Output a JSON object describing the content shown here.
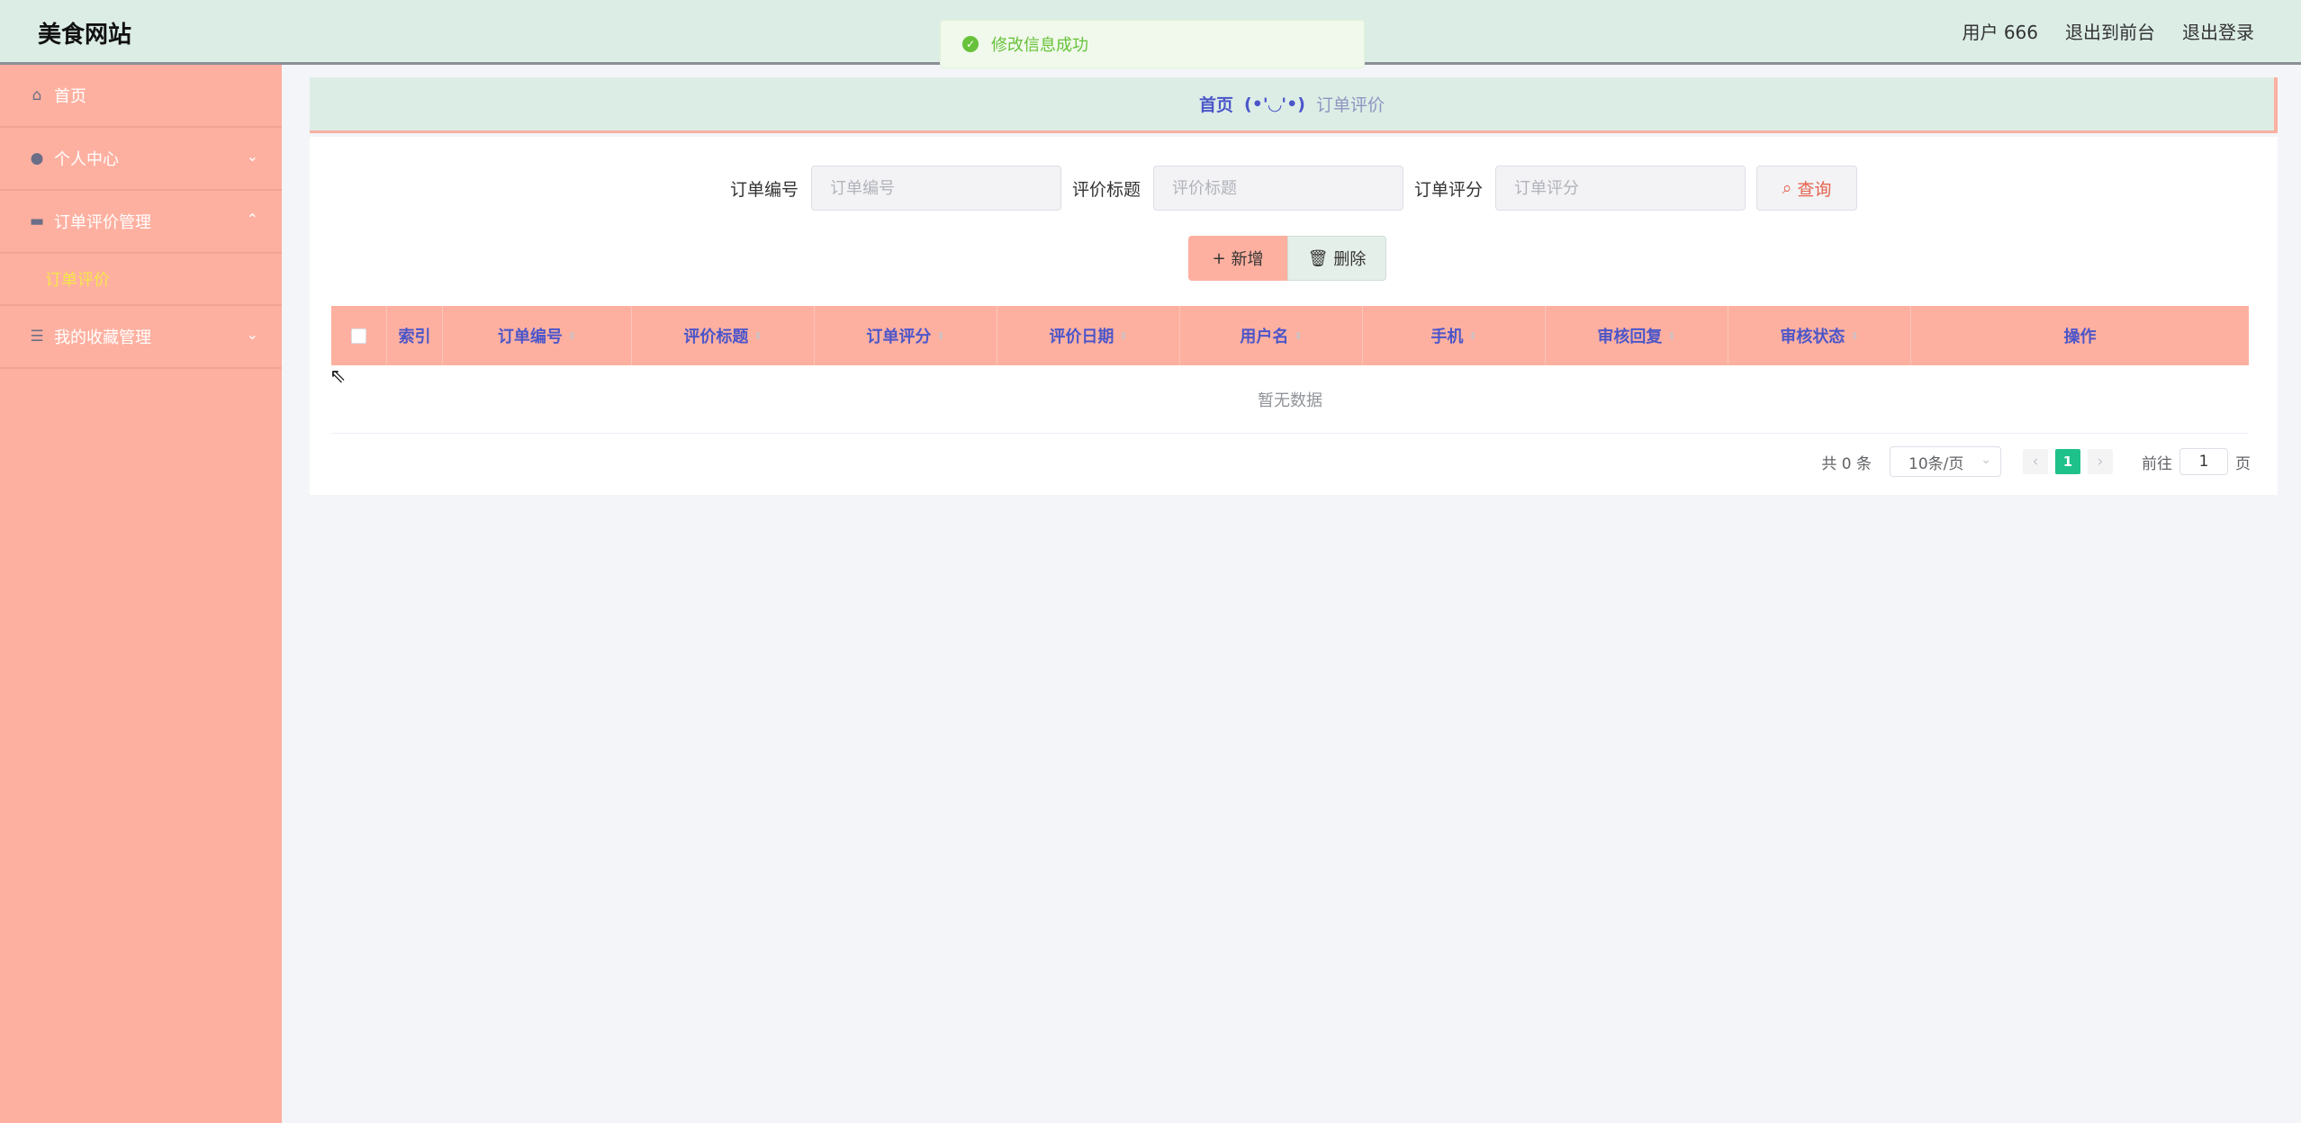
{
  "header": {
    "brand": "美食网站",
    "user": "用户 666",
    "back_to_front": "退出到前台",
    "logout": "退出登录"
  },
  "toast": {
    "message": "修改信息成功"
  },
  "sidebar": {
    "items": [
      {
        "icon": "home-icon",
        "label": "首页"
      },
      {
        "icon": "user-icon",
        "label": "个人中心"
      },
      {
        "icon": "comment-icon",
        "label": "订单评价管理",
        "sub": [
          "订单评价"
        ]
      },
      {
        "icon": "list-icon",
        "label": "我的收藏管理"
      }
    ]
  },
  "breadcrumb": {
    "home": "首页",
    "face": "(•'◡'•)",
    "current": "订单评价"
  },
  "search": {
    "order_no_label": "订单编号",
    "order_no_placeholder": "订单编号",
    "title_label": "评价标题",
    "title_placeholder": "评价标题",
    "score_label": "订单评分",
    "score_placeholder": "订单评分",
    "query": "查询"
  },
  "actions": {
    "add": "新增",
    "delete": "删除"
  },
  "table": {
    "columns": [
      "索引",
      "订单编号",
      "评价标题",
      "订单评分",
      "评价日期",
      "用户名",
      "手机",
      "审核回复",
      "审核状态",
      "操作"
    ],
    "empty": "暂无数据"
  },
  "pagination": {
    "total": "共 0 条",
    "page_size": "10条/页",
    "current_page": "1",
    "goto_label": "前往",
    "goto_value": "1",
    "page_suffix": "页"
  },
  "colors": {
    "accent": "#feb0a0",
    "header": "#dcede6",
    "link": "#4c56c9",
    "active_page": "#1ec189"
  }
}
